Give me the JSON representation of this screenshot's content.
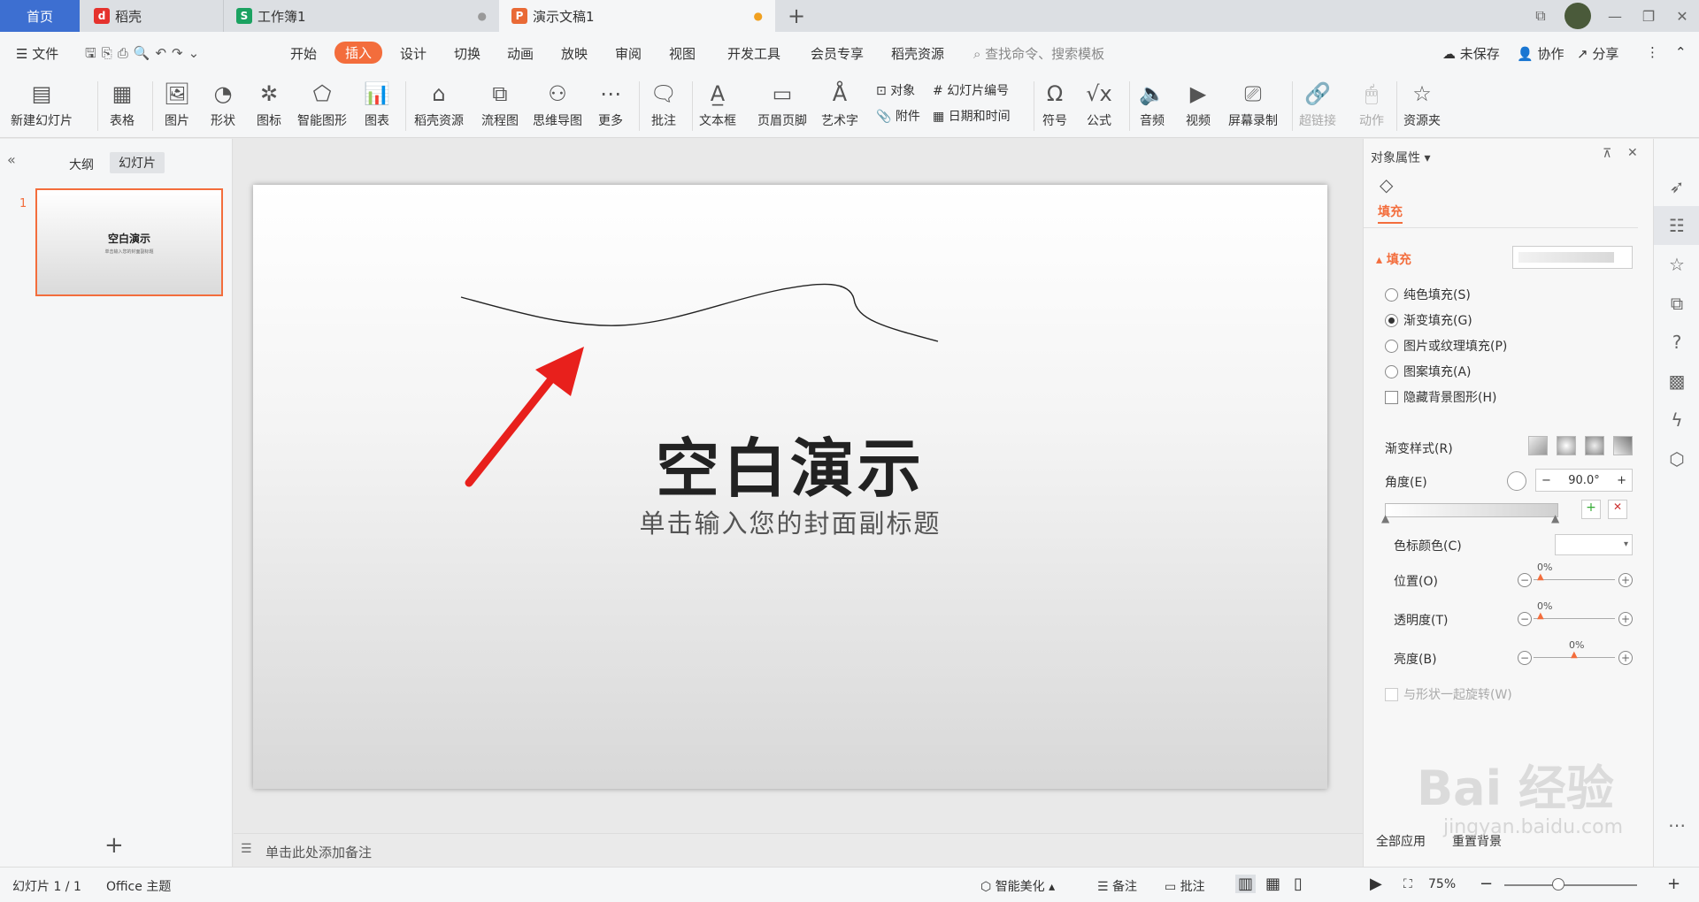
{
  "tabs": {
    "home": "首页",
    "daoke": "稻壳",
    "sheet": "工作簿1",
    "doc": "演示文稿1"
  },
  "menu": {
    "file": "文件",
    "items": [
      "开始",
      "插入",
      "设计",
      "切换",
      "动画",
      "放映",
      "审阅",
      "视图",
      "开发工具",
      "会员专享",
      "稻壳资源"
    ],
    "search_placeholder": "查找命令、搜索模板",
    "unsaved": "未保存",
    "collab": "协作",
    "share": "分享"
  },
  "ribbon": {
    "new_slide": "新建幻灯片",
    "table": "表格",
    "picture": "图片",
    "shape": "形状",
    "icon": "图标",
    "smart_shape": "智能图形",
    "chart": "图表",
    "daoke_res": "稻壳资源",
    "flowchart": "流程图",
    "mindmap": "思维导图",
    "more": "更多",
    "comment": "批注",
    "textbox": "文本框",
    "header_footer": "页眉页脚",
    "wordart": "艺术字",
    "object": "对象",
    "attachment": "附件",
    "slide_number": "幻灯片编号",
    "datetime": "日期和时间",
    "symbol": "符号",
    "formula": "公式",
    "audio": "音频",
    "video": "视频",
    "screen_record": "屏幕录制",
    "hyperlink": "超链接",
    "action": "动作",
    "resource": "资源夹"
  },
  "left": {
    "outline_tab": "大纲",
    "slides_tab": "幻灯片",
    "slide_num": "1",
    "thumb_title": "空白演示",
    "thumb_subtitle": "单击输入您的封面副标题"
  },
  "slide": {
    "title": "空白演示",
    "subtitle": "单击输入您的封面副标题"
  },
  "notes_placeholder": "单击此处添加备注",
  "panel": {
    "title": "对象属性",
    "tab_fill": "填充",
    "section_fill": "填充",
    "options": [
      "纯色填充(S)",
      "渐变填充(G)",
      "图片或纹理填充(P)",
      "图案填充(A)"
    ],
    "selected_option": 1,
    "hide_bg": "隐藏背景图形(H)",
    "gradient_style": "渐变样式(R)",
    "angle_label": "角度(E)",
    "angle_value": "90.0°",
    "stop_color": "色标颜色(C)",
    "position": "位置(O)",
    "position_value": "0%",
    "transparency": "透明度(T)",
    "transparency_value": "0%",
    "brightness": "亮度(B)",
    "brightness_value": "0%",
    "rotate_with_shape": "与形状一起旋转(W)",
    "apply_all": "全部应用",
    "reset_bg": "重置背景"
  },
  "status": {
    "slide_info": "幻灯片 1 / 1",
    "theme": "Office 主题",
    "beautify": "智能美化",
    "notes": "备注",
    "comment": "批注",
    "zoom": "75%"
  },
  "watermark": {
    "brand": "Bai 经验",
    "url": "jingyan.baidu.com"
  },
  "colors": {
    "accent": "#f36d3c",
    "home_tab": "#3d6fd1",
    "arrow": "#e8201c"
  }
}
